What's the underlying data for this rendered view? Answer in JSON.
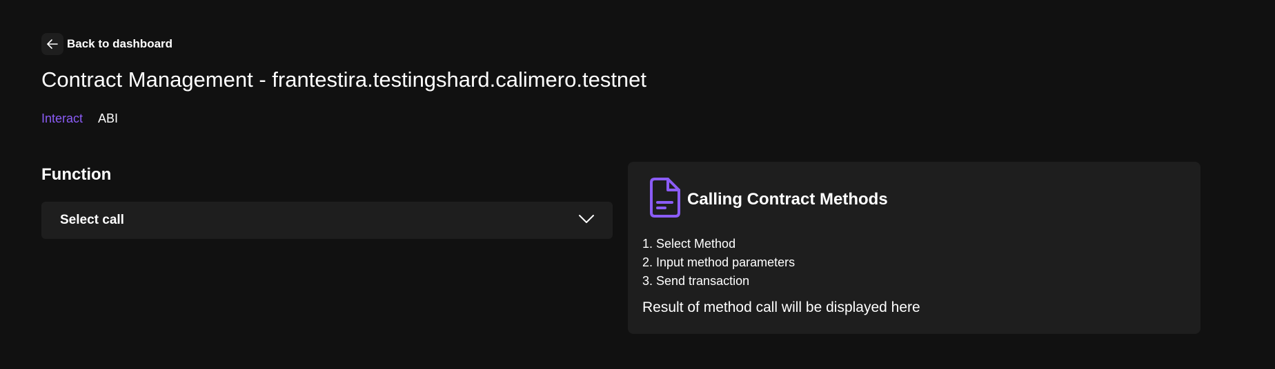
{
  "header": {
    "back_label": "Back to dashboard",
    "back_icon": "arrow-left-icon",
    "title": "Contract Management - frantestira.testingshard.calimero.testnet"
  },
  "tabs": [
    {
      "label": "Interact",
      "active": true
    },
    {
      "label": "ABI",
      "active": false
    }
  ],
  "function_section": {
    "label": "Function",
    "select_value": "Select call",
    "select_icon": "chevron-down-icon"
  },
  "info_panel": {
    "icon": "document-icon",
    "title": "Calling Contract Methods",
    "steps": [
      "1. Select Method",
      "2. Input method parameters",
      "3. Send transaction"
    ],
    "result_text": "Result of method call will be displayed here"
  },
  "colors": {
    "background": "#111111",
    "surface": "#1e1e1e",
    "accent": "#8b5cf6",
    "text": "#ffffff"
  }
}
